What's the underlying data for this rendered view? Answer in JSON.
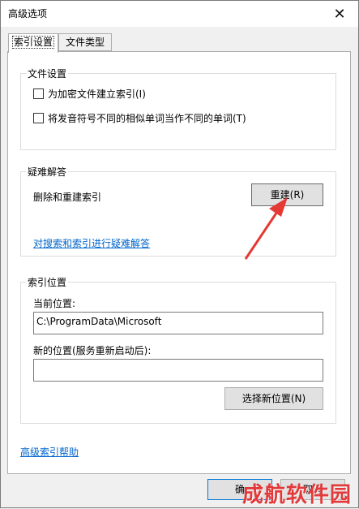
{
  "window": {
    "title": "高级选项",
    "close_glyph": "✕"
  },
  "tabs": [
    {
      "label": "索引设置",
      "active": true
    },
    {
      "label": "文件类型",
      "active": false
    }
  ],
  "file_settings": {
    "title": "文件设置",
    "options": [
      {
        "label": "为加密文件建立索引(I)",
        "checked": false
      },
      {
        "label": "将发音符号不同的相似单词当作不同的单词(T)",
        "checked": false
      }
    ]
  },
  "troubleshoot": {
    "title": "疑难解答",
    "rebuild_text": "删除和重建索引",
    "rebuild_button": "重建(R)",
    "link": "对搜索和索引进行疑难解答"
  },
  "index_location": {
    "title": "索引位置",
    "current_label": "当前位置:",
    "current_value": "C:\\ProgramData\\Microsoft",
    "new_label": "新的位置(服务重新启动后):",
    "new_value": "",
    "select_button": "选择新位置(N)"
  },
  "help_link": "高级索引帮助",
  "footer": {
    "ok_partial": "确",
    "cancel_partial": "取消"
  },
  "watermark": "成航软件园",
  "colors": {
    "link": "#0066cc",
    "annotation_arrow": "#e53935",
    "watermark": "#e23a3a"
  }
}
